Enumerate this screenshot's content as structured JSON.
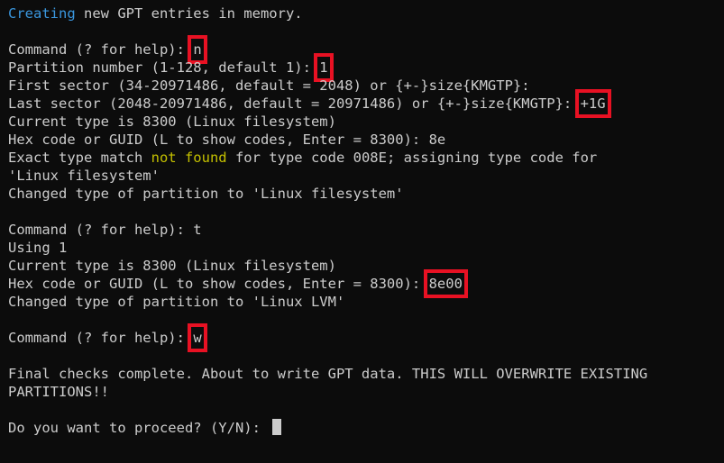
{
  "terminal": {
    "status": {
      "word": "Creating",
      "rest": " new GPT entries in memory."
    },
    "cmd1": {
      "prompt": "Command (? for help): ",
      "input": "n"
    },
    "partnum": {
      "prompt": "Partition number (1-128, default 1): ",
      "input": "1"
    },
    "first_sector": "First sector (34-20971486, default = 2048) or {+-}size{KMGTP}:",
    "last_sector": {
      "prompt": "Last sector (2048-20971486, default = 20971486) or {+-}size{KMGTP}: ",
      "input": "+1G"
    },
    "current_type_1": "Current type is 8300 (Linux filesystem)",
    "hex_code_1": "Hex code or GUID (L to show codes, Enter = 8300): 8e",
    "exact_match": {
      "before": "Exact type match ",
      "highlight": "not found",
      "after": " for type code 008E; assigning type code for"
    },
    "linux_fs": "'Linux filesystem'",
    "changed_1": "Changed type of partition to 'Linux filesystem'",
    "cmd2": "Command (? for help): t",
    "using": "Using 1",
    "current_type_2": "Current type is 8300 (Linux filesystem)",
    "hex_code_2": {
      "prompt": "Hex code or GUID (L to show codes, Enter = 8300): ",
      "input": "8e00"
    },
    "changed_2": "Changed type of partition to 'Linux LVM'",
    "cmd3": {
      "prompt": "Command (? for help): ",
      "input": "w"
    },
    "final_checks_1": "Final checks complete. About to write GPT data. THIS WILL OVERWRITE EXISTING",
    "final_checks_2": "PARTITIONS!!",
    "proceed": "Do you want to proceed? (Y/N): "
  }
}
